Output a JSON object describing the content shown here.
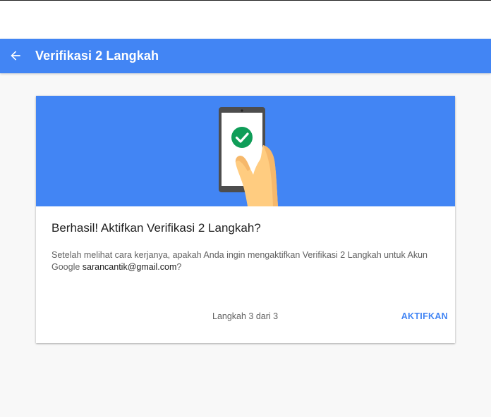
{
  "header": {
    "title": "Verifikasi 2 Langkah",
    "back_icon": "arrow-left-icon"
  },
  "card": {
    "illustration_icon": "phone-checkmark-icon",
    "title": "Berhasil! Aktifkan Verifikasi 2 Langkah?",
    "description_prefix": "Setelah melihat cara kerjanya, apakah Anda ingin mengaktifkan Verifikasi 2 Langkah untuk Akun Google ",
    "email": "sarancantik@gmail.com",
    "description_suffix": "?",
    "step_text": "Langkah 3 dari 3",
    "enable_button": "AKTIFKAN"
  },
  "colors": {
    "primary": "#4285f4",
    "check_green": "#0f9d58",
    "background": "#f8f8f8"
  }
}
